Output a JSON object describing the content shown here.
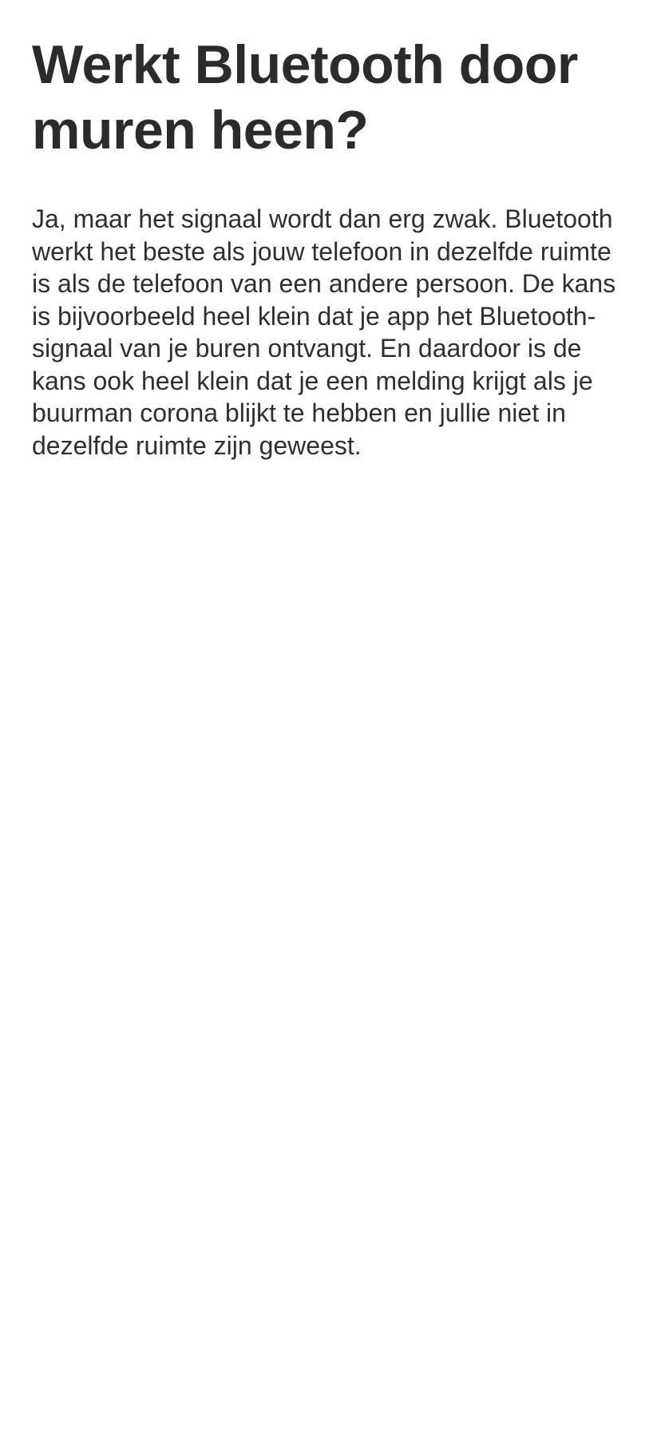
{
  "faq": {
    "question": "Werkt Bluetooth door muren heen?",
    "answer": "Ja, maar het signaal wordt dan erg zwak. Bluetooth werkt het beste als jouw telefoon in dezelfde ruimte is als de telefoon van een andere persoon. De kans is bijvoorbeeld heel klein dat je app het Bluetooth-signaal van je buren ontvangt. En daardoor is de kans ook heel klein dat je een melding krijgt als je buurman corona blijkt te hebben en jullie niet in dezelfde ruimte zijn geweest."
  },
  "colors": {
    "background": "#ffffff",
    "text": "#2b2b2b"
  }
}
